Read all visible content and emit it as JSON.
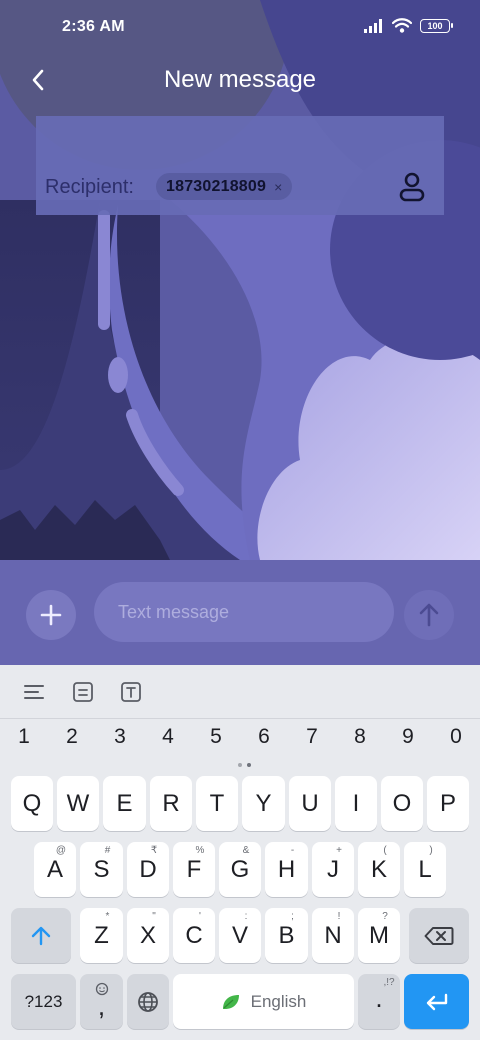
{
  "status": {
    "time": "2:36 AM",
    "battery": "100"
  },
  "header": {
    "title": "New message"
  },
  "recipient": {
    "label": "Recipient:",
    "chip": "18730218809",
    "chip_close": "×"
  },
  "compose": {
    "placeholder": "Text message"
  },
  "keyboard": {
    "numbers": [
      "1",
      "2",
      "3",
      "4",
      "5",
      "6",
      "7",
      "8",
      "9",
      "0"
    ],
    "row1": [
      {
        "key": "Q"
      },
      {
        "key": "W"
      },
      {
        "key": "E"
      },
      {
        "key": "R"
      },
      {
        "key": "T"
      },
      {
        "key": "Y"
      },
      {
        "key": "U"
      },
      {
        "key": "I"
      },
      {
        "key": "O"
      },
      {
        "key": "P"
      }
    ],
    "row2": [
      {
        "key": "A",
        "sub": "@"
      },
      {
        "key": "S",
        "sub": "#"
      },
      {
        "key": "D",
        "sub": "₹"
      },
      {
        "key": "F",
        "sub": "%"
      },
      {
        "key": "G",
        "sub": "&"
      },
      {
        "key": "H",
        "sub": "-"
      },
      {
        "key": "J",
        "sub": "+"
      },
      {
        "key": "K",
        "sub": "("
      },
      {
        "key": "L",
        "sub": ")"
      }
    ],
    "row3": [
      {
        "key": "Z",
        "sub": "*"
      },
      {
        "key": "X",
        "sub": "\""
      },
      {
        "key": "C",
        "sub": "'"
      },
      {
        "key": "V",
        "sub": ":"
      },
      {
        "key": "B",
        "sub": ";"
      },
      {
        "key": "N",
        "sub": "!"
      },
      {
        "key": "M",
        "sub": "?"
      }
    ],
    "symbols_label": "?123",
    "comma_label": ",",
    "space_label": "English",
    "period_label": ".",
    "period_sub": ",!?"
  },
  "colors": {
    "accent": "#2296f3",
    "wallpaper_base": "#5a5a9e",
    "compose_bar": "#6766b0"
  },
  "icons": {
    "back": "back-arrow-icon",
    "contact": "contact-icon",
    "attach": "plus-icon",
    "send": "send-arrow-icon",
    "shift": "shift-arrow-icon",
    "backspace": "backspace-icon",
    "emoji": "emoji-icon",
    "globe": "globe-icon",
    "leaf": "leaf-icon",
    "enter": "enter-icon"
  }
}
